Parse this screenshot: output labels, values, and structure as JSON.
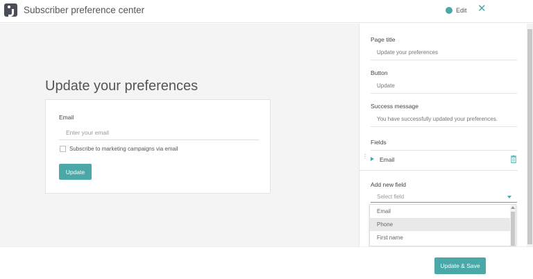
{
  "app": {
    "title": "Subscriber preference center",
    "edit_label": "Edit",
    "logo_icon": "logo-icon",
    "close_icon": "close-icon"
  },
  "preview": {
    "title": "Update your preferences",
    "email_label": "Email",
    "email_placeholder": "Enter your email",
    "checkbox_label": "Subscribe to marketing campaigns via email",
    "button_label": "Update"
  },
  "panel": {
    "page_title_label": "Page title",
    "page_title_value": "Update your preferences",
    "button_label": "Button",
    "button_value": "Update",
    "success_label": "Success message",
    "success_value": "You have successfully updated your preferences.",
    "fields_label": "Fields",
    "fields": [
      {
        "name": "Email",
        "icons": [
          "drag-handle-icon",
          "expand-caret-icon",
          "trash-icon"
        ]
      }
    ],
    "add_field_label": "Add new field",
    "select_placeholder": "Select field",
    "dropdown_options": [
      "Email",
      "Phone",
      "First name"
    ],
    "highlighted_option": "Phone"
  },
  "footer": {
    "save_label": "Update & Save"
  },
  "colors": {
    "accent": "#4aa9a8",
    "canvas_bg": "#f4f4f4"
  }
}
